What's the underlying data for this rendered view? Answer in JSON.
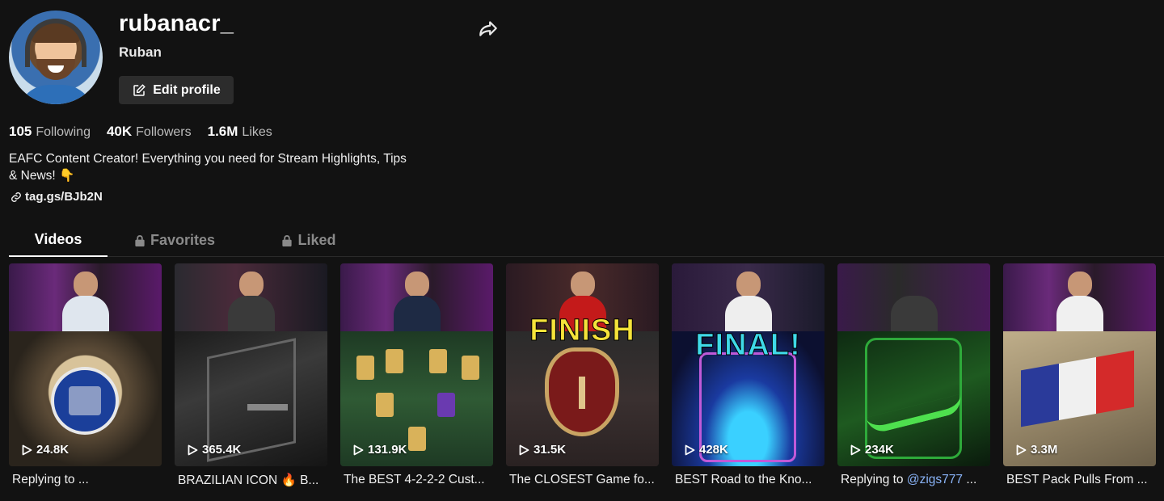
{
  "profile": {
    "username": "rubanacr_",
    "nickname": "Ruban",
    "edit_label": "Edit profile",
    "stats": [
      {
        "value": "105",
        "label": "Following"
      },
      {
        "value": "40K",
        "label": "Followers"
      },
      {
        "value": "1.6M",
        "label": "Likes"
      }
    ],
    "bio_line1": "EAFC Content Creator! Everything you need for Stream Highlights, Tips",
    "bio_line2": "& News! 👇",
    "link": "tag.gs/BJb2N"
  },
  "tabs": [
    {
      "label": "Videos",
      "locked": false
    },
    {
      "label": "Favorites",
      "locked": true
    },
    {
      "label": "Liked",
      "locked": true
    }
  ],
  "videos": [
    {
      "views": "24.8K",
      "caption": "Replying to ...",
      "overlay": ""
    },
    {
      "views": "365.4K",
      "caption": "BRAZILIAN ICON 🔥 B...",
      "overlay": ""
    },
    {
      "views": "131.9K",
      "caption": "The BEST 4-2-2-2 Cust...",
      "overlay": ""
    },
    {
      "views": "31.5K",
      "caption": "The CLOSEST Game fo...",
      "overlay": "FINISH"
    },
    {
      "views": "428K",
      "caption": "BEST Road to the Kno...",
      "overlay": "FINAL!"
    },
    {
      "views": "234K",
      "caption_prefix": "Replying to ",
      "caption_mention": "@zigs777",
      "caption_suffix": " ...",
      "overlay": ""
    },
    {
      "views": "3.3M",
      "caption": "BEST Pack Pulls From ...",
      "overlay": ""
    }
  ],
  "colors": {
    "background": "#121212",
    "mention": "#8ab4f8",
    "overlay_yellow": "#f5e33a",
    "overlay_cyan": "#3fd9e8"
  }
}
